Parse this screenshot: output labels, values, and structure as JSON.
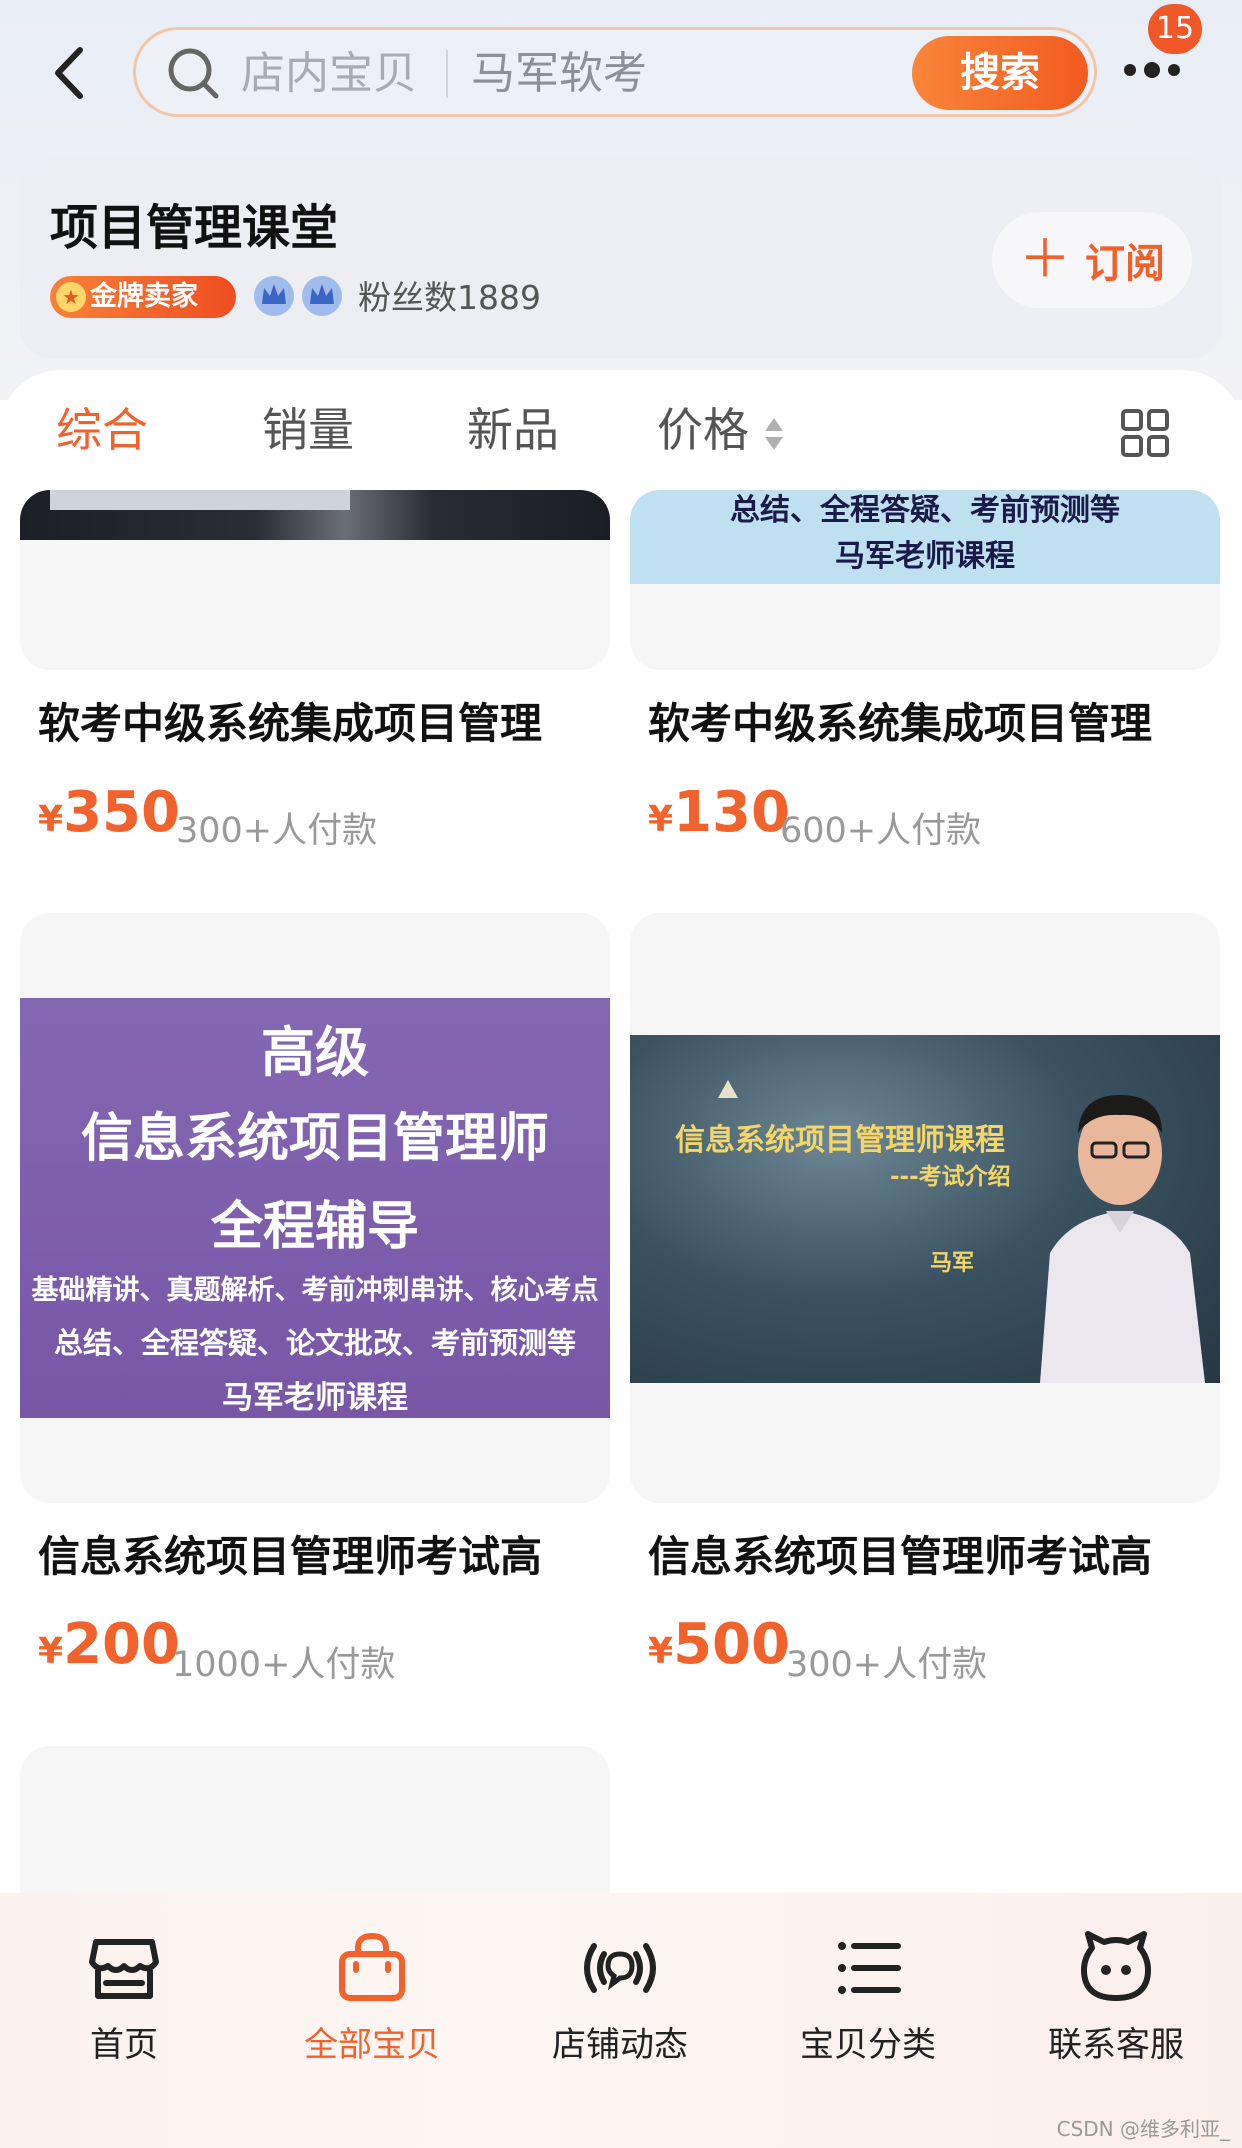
{
  "header": {
    "search_left": "店内宝贝",
    "search_right": "马军软考",
    "search_button": "搜索",
    "badge_count": "15"
  },
  "shop": {
    "name": "项目管理课堂",
    "seller_badge": "金牌卖家",
    "fans": "粉丝数1889",
    "subscribe": "订阅"
  },
  "sort_tabs": [
    "综合",
    "销量",
    "新品",
    "价格"
  ],
  "products": [
    {
      "title": "软考中级系统集成项目管理",
      "price": "350",
      "sold": "300+人付款"
    },
    {
      "title": "软考中级系统集成项目管理",
      "price": "130",
      "sold": "600+人付款",
      "image_lines": [
        "总结、全程答疑、考前预测等",
        "马军老师课程"
      ]
    },
    {
      "title": "信息系统项目管理师考试高",
      "price": "200",
      "sold": "1000+人付款",
      "image_lines": [
        "高级",
        "信息系统项目管理师",
        "全程辅导",
        "基础精讲、真题解析、考前冲刺串讲、核心考点",
        "总结、全程答疑、论文批改、考前预测等",
        "马军老师课程"
      ]
    },
    {
      "title": "信息系统项目管理师考试高",
      "price": "500",
      "sold": "300+人付款",
      "image_lines": [
        "信息系统项目管理师课程",
        "---考试介绍",
        "马军"
      ]
    }
  ],
  "currency": "¥",
  "tabbar": [
    "首页",
    "全部宝贝",
    "店铺动态",
    "宝贝分类",
    "联系客服"
  ],
  "watermark": "CSDN @维多利亚_",
  "colors": {
    "accent": "#f2622c",
    "purple_banner": "#7a5aa8"
  }
}
